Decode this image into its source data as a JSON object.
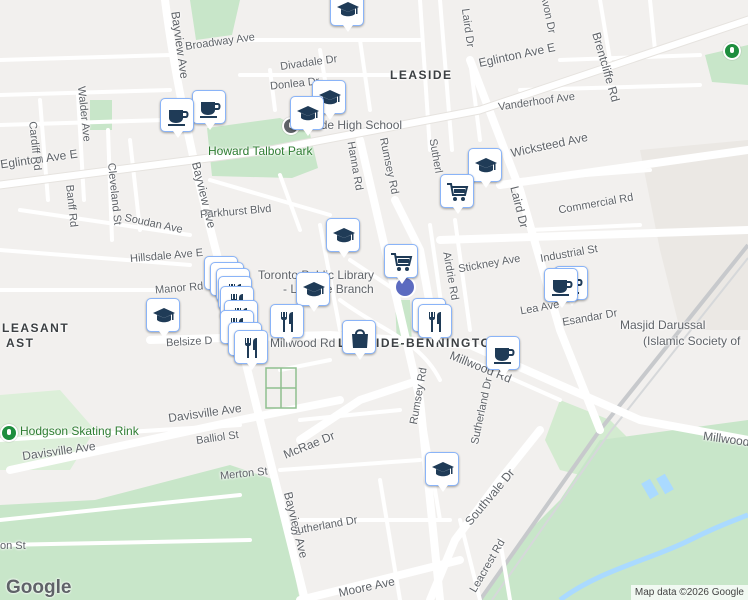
{
  "colors": {
    "road": "#ffffff",
    "arterial": "#dadce0",
    "park": "#c8e6c9",
    "water": "#aadaff",
    "pin_border": "#8ab4f8",
    "icon": "#1f3b57"
  },
  "neighbourhoods": {
    "leaside": "LEASIDE",
    "pleasant_top": "LEASANT",
    "pleasant_bottom": "AST",
    "leaside_bennington": "LEASIDE-BENNINGTON"
  },
  "roads": {
    "eglinton_w": "Eglinton Ave E",
    "eglinton_e": "Eglinton Ave E",
    "broadway": "Broadway Ave",
    "divadale": "Divadale Dr",
    "donlea": "Donlea Dr",
    "vanderhoof": "Vanderhoof Ave",
    "bayview_top": "Bayview Ave",
    "bayview_mid": "Bayview Ave",
    "bayview_bottom": "Bayview Ave",
    "cardiff": "Cardiff Rd",
    "walder": "Walder Ave",
    "banff": "Banff Rd",
    "cleveland": "Cleveland St",
    "hanna": "Hanna Rd",
    "rumsey_top": "Rumsey Rd",
    "rumsey_bottom": "Rumsey Rd",
    "sutherland_top": "Sutherl",
    "sutherland_dr": "Sutherland Dr",
    "sutherland_bottom": "Sutherland Dr",
    "wicksteed": "Wicksteed Ave",
    "laird_top": "Laird Dr",
    "laird": "Laird Dr",
    "avon": "Avon Dr",
    "brentcliffe": "Brentcliffe Rd",
    "soudan": "Soudan Ave",
    "parkhurst": "Parkhurst Blvd",
    "hillsdale": "Hillsdale Ave E",
    "manor": "Manor Rd E",
    "belsize": "Belsize D",
    "millwood_w": "Millwood Rd",
    "millwood_mid": "Millwood Rd",
    "millwood_e": "Millwood",
    "commercial": "Commercial Rd",
    "industrial": "Industrial St",
    "stickney": "Stickney Ave",
    "airdrie": "Airdrie Rd",
    "lea": "Lea Ave",
    "esandar": "Esandar Dr",
    "davisville_ave": "Davisville Ave",
    "davisville_ave2": "Davisville Ave",
    "balliol": "Balliol St",
    "mcrae": "McRae Dr",
    "merton": "Merton St",
    "southvale": "Southvale Dr",
    "leacrest": "Leacrest Rd",
    "moore": "Moore Ave",
    "on_st": "on St"
  },
  "pois": {
    "leaside_high": "Leaside High School",
    "howard_talbot": "Howard Talbot Park",
    "library_1": "Toronto Public Library",
    "library_2": "- Leaside Branch",
    "masjid_1": "Masjid Darussal",
    "masjid_2": "(Islamic Society of",
    "hodgson": "Hodgson Skating Rink"
  },
  "markers": [
    {
      "icon": "school-icon",
      "name": "school-marker"
    },
    {
      "icon": "cafe-icon",
      "name": "cafe-marker"
    },
    {
      "icon": "grocery-icon",
      "name": "grocery-marker"
    },
    {
      "icon": "restaurant-icon",
      "name": "restaurant-marker"
    },
    {
      "icon": "shopping-icon",
      "name": "shopping-marker"
    }
  ],
  "footer": {
    "logo": "Google",
    "attribution": "Map data ©2026 Google"
  }
}
